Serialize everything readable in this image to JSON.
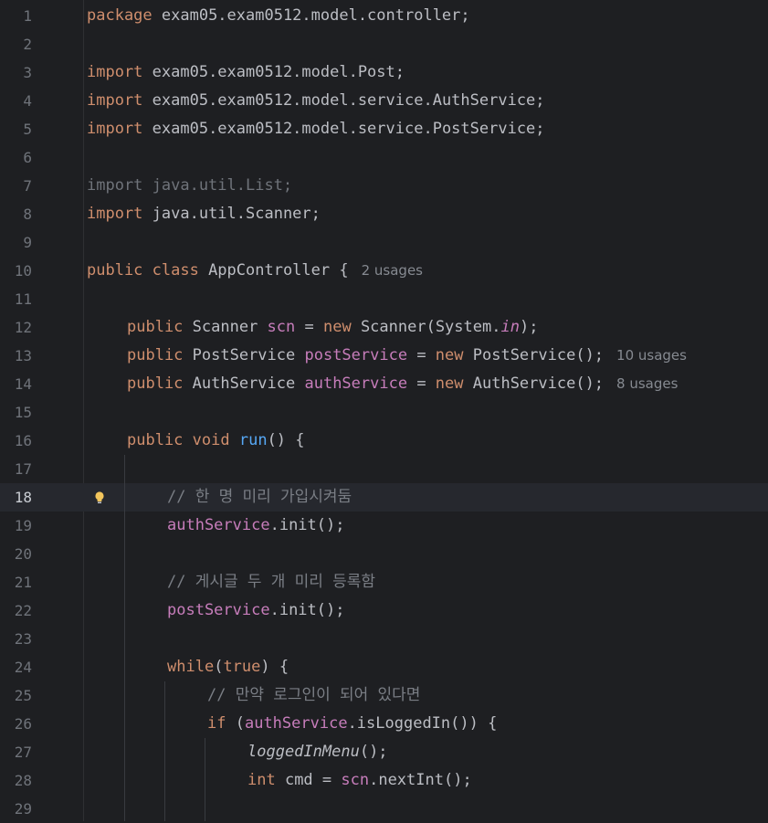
{
  "lines": [
    {
      "n": "1",
      "indent": 0,
      "tokens": [
        {
          "c": "kw",
          "t": "package"
        },
        {
          "c": "",
          "t": " exam05.exam0512.model.controller;"
        }
      ]
    },
    {
      "n": "2",
      "indent": 0,
      "tokens": []
    },
    {
      "n": "3",
      "indent": 0,
      "tokens": [
        {
          "c": "kw",
          "t": "import"
        },
        {
          "c": "",
          "t": " exam05.exam0512.model.Post;"
        }
      ]
    },
    {
      "n": "4",
      "indent": 0,
      "tokens": [
        {
          "c": "kw",
          "t": "import"
        },
        {
          "c": "",
          "t": " exam05.exam0512.model.service.AuthService;"
        }
      ]
    },
    {
      "n": "5",
      "indent": 0,
      "tokens": [
        {
          "c": "kw",
          "t": "import"
        },
        {
          "c": "",
          "t": " exam05.exam0512.model.service.PostService;"
        }
      ]
    },
    {
      "n": "6",
      "indent": 0,
      "tokens": []
    },
    {
      "n": "7",
      "indent": 0,
      "tokens": [
        {
          "c": "dim",
          "t": "import java.util.List;"
        }
      ]
    },
    {
      "n": "8",
      "indent": 0,
      "tokens": [
        {
          "c": "kw",
          "t": "import"
        },
        {
          "c": "",
          "t": " java.util.Scanner;"
        }
      ]
    },
    {
      "n": "9",
      "indent": 0,
      "tokens": []
    },
    {
      "n": "10",
      "indent": 0,
      "tokens": [
        {
          "c": "kw",
          "t": "public class"
        },
        {
          "c": "",
          "t": " AppController {"
        }
      ],
      "hint": "2 usages"
    },
    {
      "n": "11",
      "indent": 0,
      "tokens": []
    },
    {
      "n": "12",
      "indent": 1,
      "tokens": [
        {
          "c": "kw",
          "t": "public"
        },
        {
          "c": "",
          "t": " Scanner "
        },
        {
          "c": "fld",
          "t": "scn"
        },
        {
          "c": "",
          "t": " = "
        },
        {
          "c": "kw",
          "t": "new"
        },
        {
          "c": "",
          "t": " Scanner(System."
        },
        {
          "c": "fld ital",
          "t": "in"
        },
        {
          "c": "",
          "t": ");"
        }
      ]
    },
    {
      "n": "13",
      "indent": 1,
      "tokens": [
        {
          "c": "kw",
          "t": "public"
        },
        {
          "c": "",
          "t": " PostService "
        },
        {
          "c": "fld",
          "t": "postService"
        },
        {
          "c": "",
          "t": " = "
        },
        {
          "c": "kw",
          "t": "new"
        },
        {
          "c": "",
          "t": " PostService();"
        }
      ],
      "hint": "10 usages"
    },
    {
      "n": "14",
      "indent": 1,
      "tokens": [
        {
          "c": "kw",
          "t": "public"
        },
        {
          "c": "",
          "t": " AuthService "
        },
        {
          "c": "fld",
          "t": "authService"
        },
        {
          "c": "",
          "t": " = "
        },
        {
          "c": "kw",
          "t": "new"
        },
        {
          "c": "",
          "t": " AuthService();"
        }
      ],
      "hint": "8 usages"
    },
    {
      "n": "15",
      "indent": 0,
      "tokens": []
    },
    {
      "n": "16",
      "indent": 1,
      "tokens": [
        {
          "c": "kw",
          "t": "public void"
        },
        {
          "c": "",
          "t": " "
        },
        {
          "c": "mth",
          "t": "run"
        },
        {
          "c": "",
          "t": "() {"
        }
      ]
    },
    {
      "n": "17",
      "indent": 0,
      "tokens": []
    },
    {
      "n": "18",
      "indent": 2,
      "tokens": [
        {
          "c": "cmt",
          "t": "// 한 명 미리 가입시켜둠"
        }
      ],
      "current": true,
      "bulb": true
    },
    {
      "n": "19",
      "indent": 2,
      "tokens": [
        {
          "c": "fld",
          "t": "authService"
        },
        {
          "c": "",
          "t": ".init();"
        }
      ]
    },
    {
      "n": "20",
      "indent": 0,
      "tokens": []
    },
    {
      "n": "21",
      "indent": 2,
      "tokens": [
        {
          "c": "cmt",
          "t": "// 게시글 두 개 미리 등록함"
        }
      ]
    },
    {
      "n": "22",
      "indent": 2,
      "tokens": [
        {
          "c": "fld",
          "t": "postService"
        },
        {
          "c": "",
          "t": ".init();"
        }
      ]
    },
    {
      "n": "23",
      "indent": 0,
      "tokens": []
    },
    {
      "n": "24",
      "indent": 2,
      "tokens": [
        {
          "c": "kw",
          "t": "while"
        },
        {
          "c": "",
          "t": "("
        },
        {
          "c": "kw",
          "t": "true"
        },
        {
          "c": "",
          "t": ") {"
        }
      ]
    },
    {
      "n": "25",
      "indent": 3,
      "tokens": [
        {
          "c": "cmt",
          "t": "// 만약 로그인이 되어 있다면"
        }
      ]
    },
    {
      "n": "26",
      "indent": 3,
      "tokens": [
        {
          "c": "kw",
          "t": "if"
        },
        {
          "c": "",
          "t": " ("
        },
        {
          "c": "fld",
          "t": "authService"
        },
        {
          "c": "",
          "t": ".isLoggedIn()) {"
        }
      ]
    },
    {
      "n": "27",
      "indent": 4,
      "tokens": [
        {
          "c": "ital",
          "t": "loggedInMenu"
        },
        {
          "c": "",
          "t": "();"
        }
      ]
    },
    {
      "n": "28",
      "indent": 4,
      "tokens": [
        {
          "c": "kw",
          "t": "int"
        },
        {
          "c": "",
          "t": " cmd = "
        },
        {
          "c": "fld",
          "t": "scn"
        },
        {
          "c": "",
          "t": ".nextInt();"
        }
      ]
    },
    {
      "n": "29",
      "indent": 0,
      "tokens": []
    }
  ]
}
